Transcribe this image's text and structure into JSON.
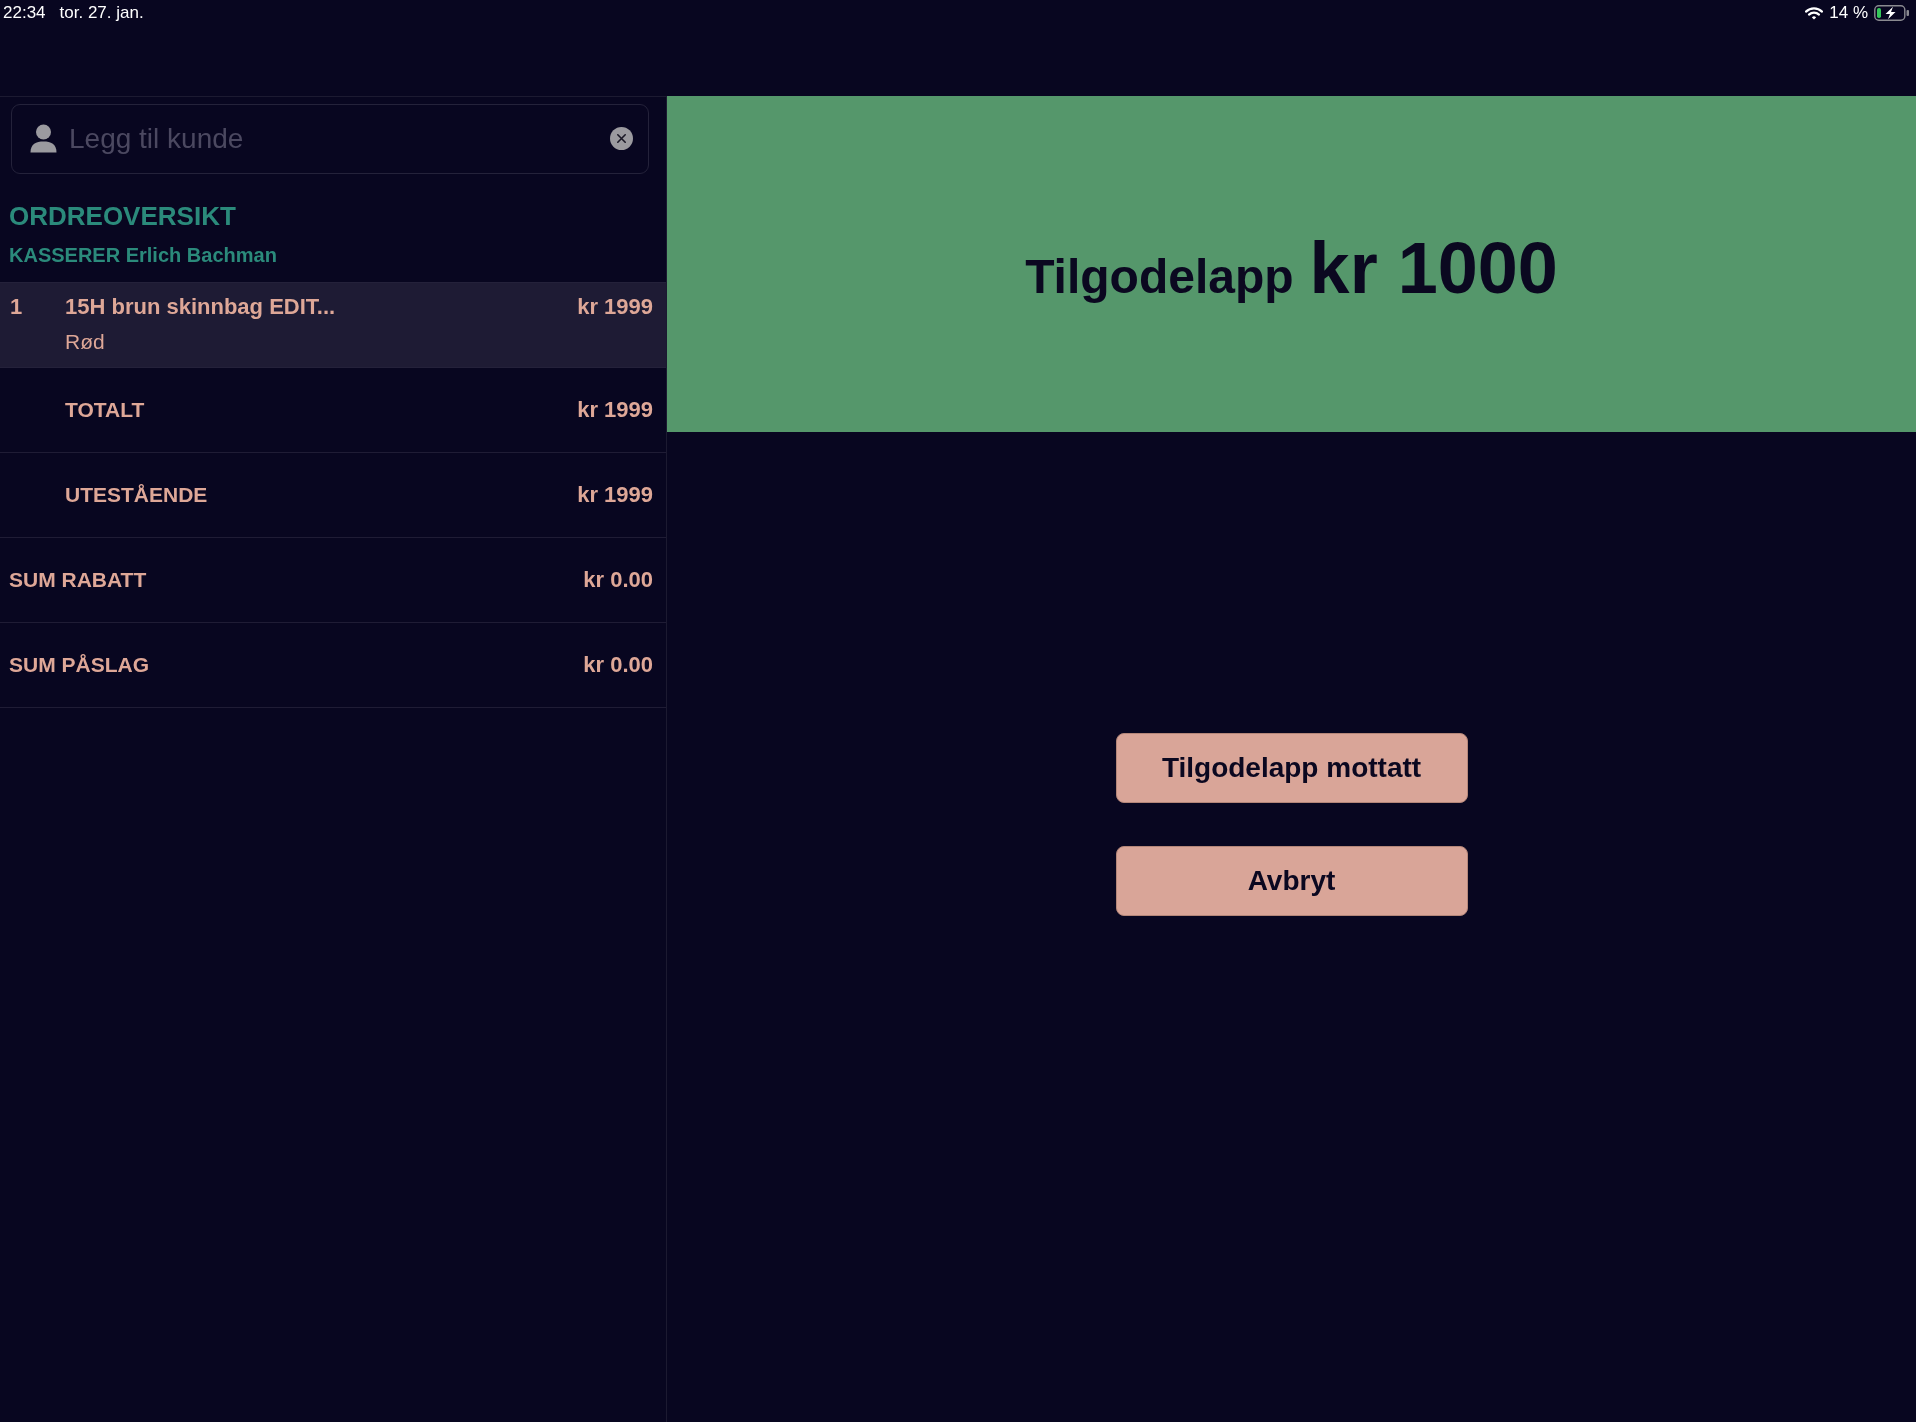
{
  "status_bar": {
    "time": "22:34",
    "date": "tor. 27. jan.",
    "battery": "14 %"
  },
  "customer_search": {
    "placeholder": "Legg til kunde"
  },
  "order_overview": {
    "title": "ORDREOVERSIKT",
    "cashier": "KASSERER Erlich Bachman"
  },
  "order_lines": [
    {
      "quantity": "1",
      "name": "15H brun skinnbag EDIT...",
      "variant": "Rød",
      "price": "kr 1999",
      "selected": true
    }
  ],
  "summary": [
    {
      "kind": "total",
      "label": "TOTALT",
      "value": "kr 1999"
    },
    {
      "kind": "total",
      "label": "UTESTÅENDE",
      "value": "kr 1999"
    },
    {
      "kind": "sum",
      "label": "SUM RABATT",
      "value": "kr 0.00"
    },
    {
      "kind": "sum",
      "label": "SUM PÅSLAG",
      "value": "kr 0.00"
    }
  ],
  "voucher": {
    "label": "Tilgodelapp",
    "amount": "kr 1000"
  },
  "buttons": [
    "Tilgodelapp mottatt",
    "Avbryt"
  ]
}
